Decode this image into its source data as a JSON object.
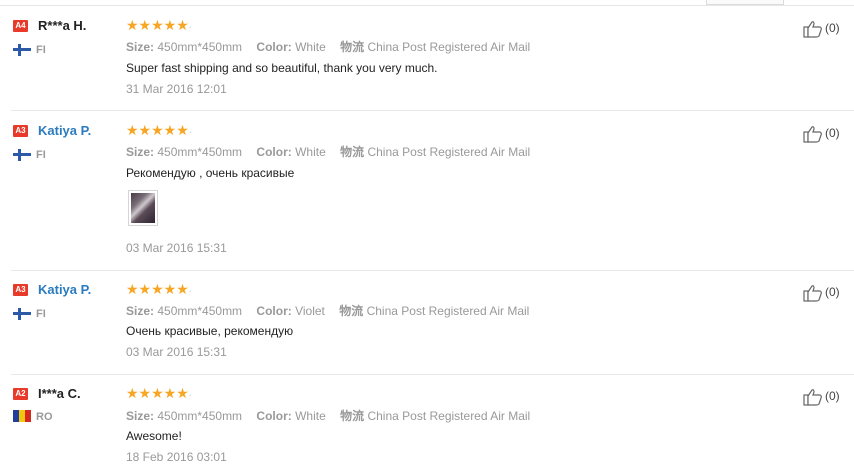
{
  "reviews": [
    {
      "level": "A4",
      "name": "R***a H.",
      "name_color": "dark",
      "country": "FI",
      "flag": "fi",
      "stars": "★★★★★",
      "size_label": "Size:",
      "size_value": "450mm*450mm",
      "color_label": "Color:",
      "color_value": "White",
      "shipping_label": "物流",
      "shipping_value": "China Post Registered Air Mail",
      "text": "Super fast shipping and so beautiful, thank you very much.",
      "date": "31 Mar 2016 12:01",
      "helpful": "(0)"
    },
    {
      "level": "A3",
      "name": "Katiya P.",
      "name_color": "blue",
      "country": "FI",
      "flag": "fi",
      "stars": "★★★★★",
      "size_label": "Size:",
      "size_value": "450mm*450mm",
      "color_label": "Color:",
      "color_value": "White",
      "shipping_label": "物流",
      "shipping_value": "China Post Registered Air Mail",
      "text": "Рекомендую , очень красивые",
      "date": "03 Mar 2016 15:31",
      "helpful": "(0)"
    },
    {
      "level": "A3",
      "name": "Katiya P.",
      "name_color": "blue",
      "country": "FI",
      "flag": "fi",
      "stars": "★★★★★",
      "size_label": "Size:",
      "size_value": "450mm*450mm",
      "color_label": "Color:",
      "color_value": "Violet",
      "shipping_label": "物流",
      "shipping_value": "China Post Registered Air Mail",
      "text": "Очень красивые, рекомендую",
      "date": "03 Mar 2016 15:31",
      "helpful": "(0)"
    },
    {
      "level": "A2",
      "name": "I***a C.",
      "name_color": "dark",
      "country": "RO",
      "flag": "ro",
      "stars": "★★★★★",
      "size_label": "Size:",
      "size_value": "450mm*450mm",
      "color_label": "Color:",
      "color_value": "White",
      "shipping_label": "物流",
      "shipping_value": "China Post Registered Air Mail",
      "text": "Awesome!",
      "date": "18 Feb 2016 03:01",
      "helpful": "(0)"
    }
  ],
  "icons": {
    "like": "thumbs-up-icon",
    "photo": "review-photo-thumbnail"
  },
  "colors": {
    "star": "#f6a623",
    "level_badge": "#e83a2a",
    "name_blue": "#2a7bbf",
    "fi_cross": "#2d5aa8",
    "ro_flag": [
      "#1f3f9a",
      "#f3c90f",
      "#d52b1e"
    ]
  }
}
